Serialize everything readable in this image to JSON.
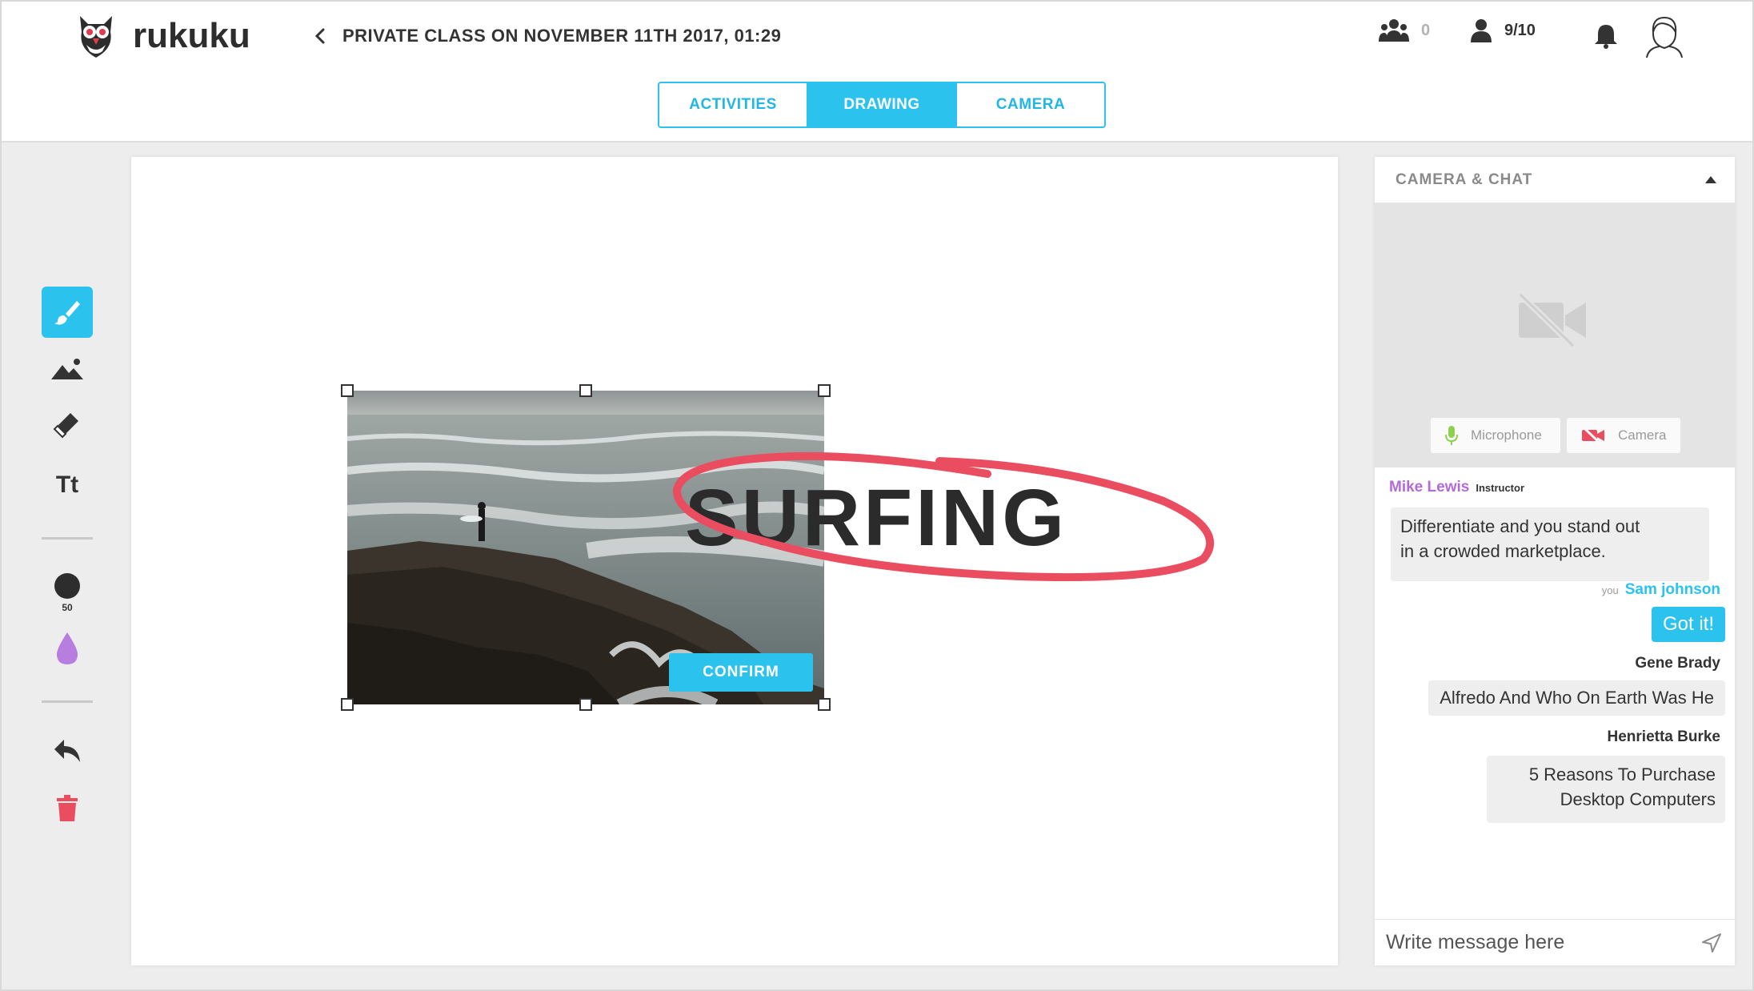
{
  "app": {
    "brand": "rukuku"
  },
  "header": {
    "class_title": "PRIVATE CLASS ON NOVEMBER 11TH 2017, 01:29",
    "group_count": "0",
    "students_count": "9/10"
  },
  "tabs": [
    {
      "label": "ACTIVITIES",
      "active": false
    },
    {
      "label": "DRAWING",
      "active": true
    },
    {
      "label": "CAMERA",
      "active": false
    }
  ],
  "toolbar": {
    "tools": [
      "brush-icon",
      "image-icon",
      "eraser-icon",
      "text-tool"
    ],
    "text_tool_label": "Tt",
    "brush_size": "50",
    "brush_color": "#b77ee0",
    "accent": "#2bc3ee",
    "delete_color": "#ea4c60"
  },
  "canvas": {
    "word": "SURFING",
    "confirm_label": "CONFIRM",
    "annotation_color": "#ea4c60"
  },
  "panel": {
    "title": "CAMERA & CHAT",
    "microphone_label": "Microphone",
    "camera_label": "Camera"
  },
  "chat": {
    "messages": [
      {
        "author": "Mike Lewis",
        "role": "Instructor",
        "text_line1": "Differentiate and you stand out",
        "text_line2": "in a crowded marketplace."
      },
      {
        "you_label": "you",
        "author": "Sam johnson",
        "text": "Got it!"
      },
      {
        "author": "Gene Brady",
        "text": "Alfredo And Who On Earth Was He"
      },
      {
        "author": "Henrietta Burke",
        "text_line1": "5 Reasons To Purchase",
        "text_line2": "Desktop Computers"
      }
    ],
    "placeholder": "Write message here"
  }
}
